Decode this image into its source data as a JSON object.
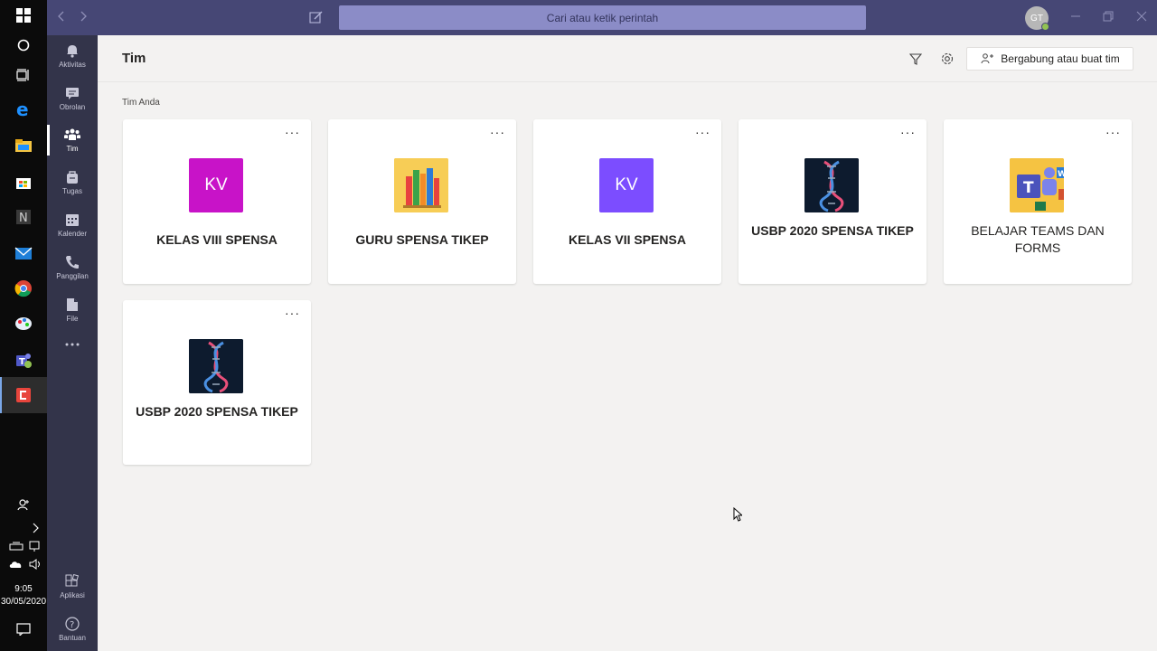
{
  "system": {
    "time": "9:05",
    "date": "30/05/2020"
  },
  "titlebar": {
    "search_placeholder": "Cari atau ketik perintah",
    "avatar_initials": "GT"
  },
  "rail": [
    {
      "label": "Aktivitas",
      "icon": "bell-icon"
    },
    {
      "label": "Obrolan",
      "icon": "chat-icon"
    },
    {
      "label": "Tim",
      "icon": "teams-icon",
      "active": true
    },
    {
      "label": "Tugas",
      "icon": "bag-icon"
    },
    {
      "label": "Kalender",
      "icon": "calendar-icon"
    },
    {
      "label": "Panggilan",
      "icon": "phone-icon"
    },
    {
      "label": "File",
      "icon": "file-icon"
    }
  ],
  "rail_bottom": [
    {
      "label": "Aplikasi",
      "icon": "apps-icon"
    },
    {
      "label": "Bantuan",
      "icon": "help-icon"
    }
  ],
  "header": {
    "title": "Tim",
    "join_button": "Bergabung atau buat tim"
  },
  "section_label": "Tim Anda",
  "teams": [
    {
      "name": "KELAS VIII SPENSA",
      "initials": "KV",
      "tile_color": "#c813c8",
      "tile": "initials"
    },
    {
      "name": "GURU SPENSA TIKEP",
      "tile": "books"
    },
    {
      "name": "KELAS VII SPENSA",
      "initials": "KV",
      "tile_color": "#7c4dff",
      "tile": "initials"
    },
    {
      "name": "USBP 2020 SPENSA TIKEP",
      "tile": "dna"
    },
    {
      "name": "BELAJAR TEAMS DAN FORMS",
      "tile": "office"
    },
    {
      "name": "USBP 2020 SPENSA TIKEP",
      "tile": "dna"
    }
  ],
  "more_label": "···",
  "colors": {
    "titlebar": "#464775",
    "rail": "#33344a",
    "main_bg": "#f3f2f1"
  }
}
